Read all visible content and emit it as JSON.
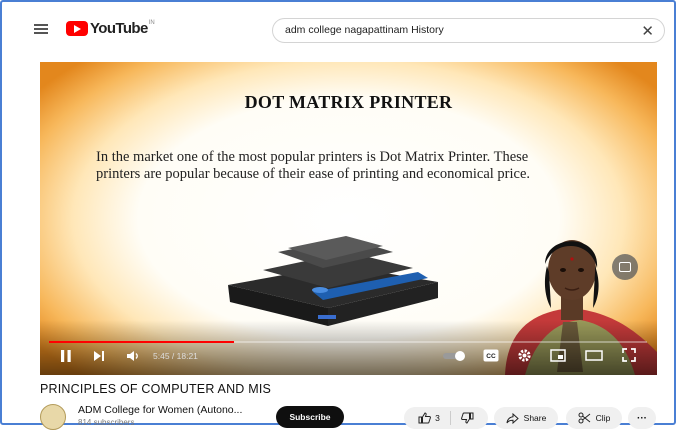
{
  "header": {
    "logo_text": "YouTube",
    "logo_sup": "IN",
    "search_value": "adm college nagapattinam History",
    "clear_symbol": "✕"
  },
  "slide": {
    "title": "DOT MATRIX PRINTER",
    "body": "In the market one of the most popular printers is Dot Matrix Printer. These printers are popular because of their ease of printing and economical price."
  },
  "player": {
    "time": "5:45 / 18:21",
    "progress": 0.31,
    "cc_label": "CC",
    "colors": {
      "progress": "#ff0000",
      "slide_border": "#e3871d"
    }
  },
  "video": {
    "title": "PRINCIPLES OF COMPUTER AND MIS",
    "channel_name": "ADM College for Women (Autono...",
    "channel_subs": "814 subscribers",
    "subscribe_label": "Subscribe",
    "like_count": "3",
    "share_label": "Share",
    "clip_label": "Clip",
    "more_label": "···"
  },
  "icons": [
    "menu-icon",
    "youtube-logo-icon",
    "close-icon",
    "pip-icon",
    "pause-icon",
    "next-icon",
    "volume-icon",
    "autoplay-icon",
    "captions-icon",
    "settings-icon",
    "miniplayer-icon",
    "theater-icon",
    "fullscreen-icon",
    "like-icon",
    "dislike-icon",
    "share-icon",
    "clip-icon",
    "more-icon"
  ]
}
